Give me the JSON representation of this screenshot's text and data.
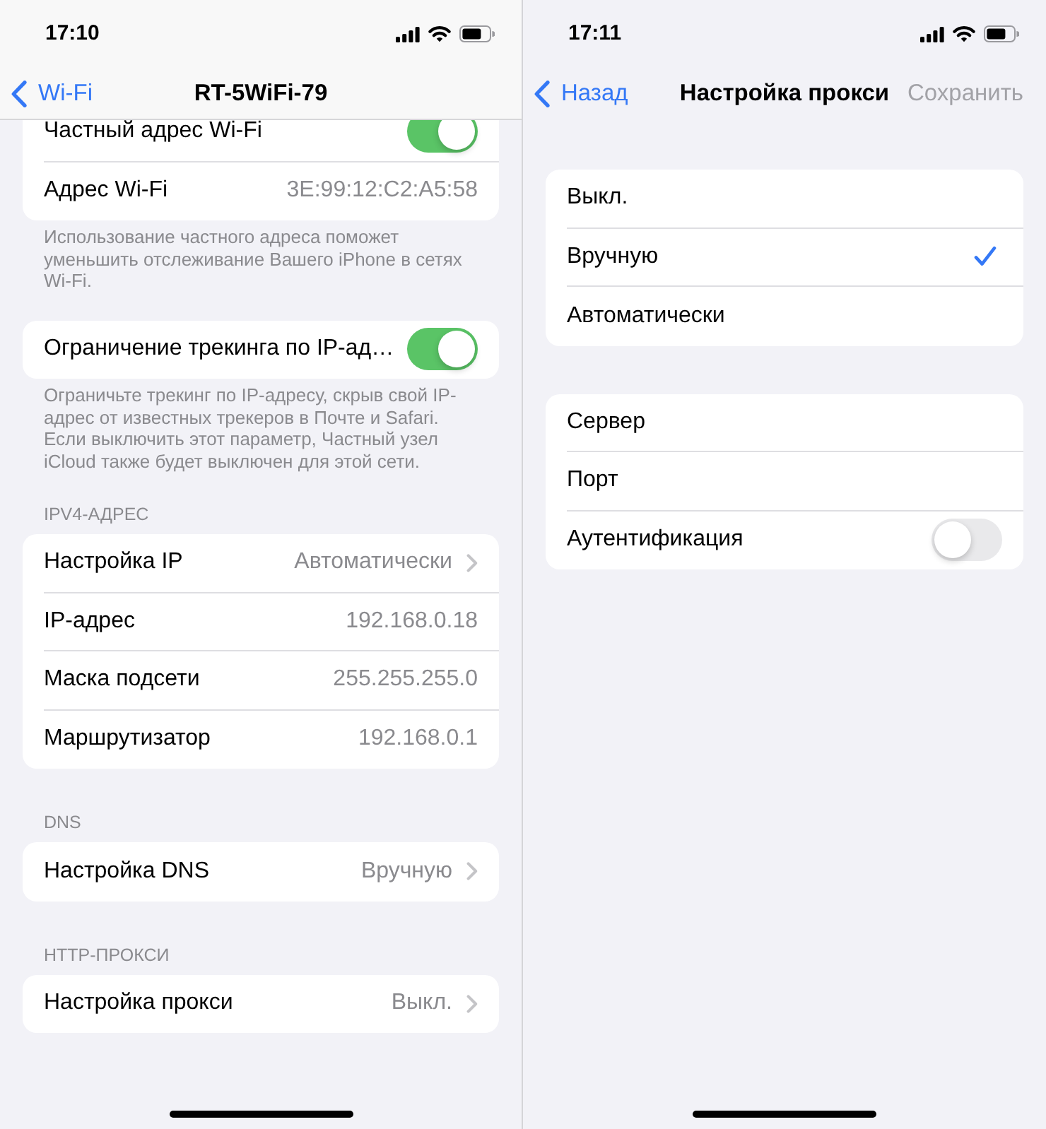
{
  "screens": [
    {
      "time": "17:10",
      "scrolled": true,
      "nav": {
        "back": "Wi-Fi",
        "title": "RT-5WiFi-79"
      },
      "sections": [
        {
          "rows": [
            {
              "kind": "toggle",
              "label": "Частный адрес Wi-Fi",
              "on": true
            },
            {
              "kind": "value",
              "label": "Адрес Wi-Fi",
              "value": "3E:99:12:C2:A5:58"
            }
          ],
          "footer": "Использование частного адреса поможет уменьшить отслеживание Вашего iPhone в сетях Wi-Fi."
        },
        {
          "rows": [
            {
              "kind": "toggle",
              "label": "Ограничение трекинга по IP-ад…",
              "on": true
            }
          ],
          "footer": "Ограничьте трекинг по IP-адресу, скрыв свой IP-адрес от известных трекеров в Почте и Safari. Если выключить этот параметр, Частный узел iCloud также будет выключен для этой сети."
        },
        {
          "header": "IPV4-АДРЕС",
          "rows": [
            {
              "kind": "detail",
              "label": "Настройка IP",
              "value": "Автоматически"
            },
            {
              "kind": "value",
              "label": "IP-адрес",
              "value": "192.168.0.18"
            },
            {
              "kind": "value",
              "label": "Маска подсети",
              "value": "255.255.255.0"
            },
            {
              "kind": "value",
              "label": "Маршрутизатор",
              "value": "192.168.0.1"
            }
          ]
        },
        {
          "header": "DNS",
          "rows": [
            {
              "kind": "detail",
              "label": "Настройка DNS",
              "value": "Вручную"
            }
          ]
        },
        {
          "header": "HTTP-ПРОКСИ",
          "rows": [
            {
              "kind": "detail",
              "label": "Настройка прокси",
              "value": "Выкл."
            }
          ]
        }
      ]
    },
    {
      "time": "17:11",
      "scrolled": false,
      "nav": {
        "back": "Назад",
        "title": "Настройка прокси",
        "action": {
          "label": "Сохранить",
          "disabled": true
        }
      },
      "sections": [
        {
          "rows": [
            {
              "kind": "choice",
              "label": "Выкл.",
              "selected": false
            },
            {
              "kind": "choice",
              "label": "Вручную",
              "selected": true
            },
            {
              "kind": "choice",
              "label": "Автоматически",
              "selected": false
            }
          ]
        },
        {
          "rows": [
            {
              "kind": "field",
              "label": "Сервер"
            },
            {
              "kind": "field",
              "label": "Порт"
            },
            {
              "kind": "toggle",
              "label": "Аутентификация",
              "on": false
            }
          ]
        }
      ]
    }
  ]
}
